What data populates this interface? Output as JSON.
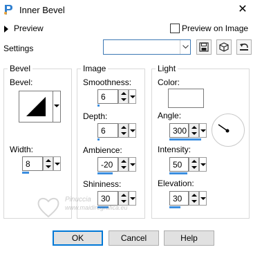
{
  "window": {
    "title": "Inner Bevel",
    "close_glyph": "✕",
    "icon": "psp-app-icon"
  },
  "preview": {
    "label": "Preview",
    "preview_on_image_label": "Preview on Image",
    "preview_on_image_checked": false
  },
  "settings": {
    "label": "Settings",
    "preset_value": ""
  },
  "bevel": {
    "group_title": "Bevel",
    "bevel_label": "Bevel:",
    "width_label": "Width:",
    "width_value": "8"
  },
  "image": {
    "group_title": "Image",
    "smoothness_label": "Smoothness:",
    "smoothness_value": "6",
    "depth_label": "Depth:",
    "depth_value": "6",
    "ambience_label": "Ambience:",
    "ambience_value": "-20",
    "shininess_label": "Shininess:",
    "shininess_value": "30"
  },
  "light": {
    "group_title": "Light",
    "color_label": "Color:",
    "color_value": "#ffffff",
    "angle_label": "Angle:",
    "angle_value": "300",
    "intensity_label": "Intensity:",
    "intensity_value": "50",
    "elevation_label": "Elevation:",
    "elevation_value": "30"
  },
  "watermark": {
    "line1": "Pinuccia",
    "line2": "www.maidiregrafica.eu"
  },
  "buttons": {
    "ok": "OK",
    "cancel": "Cancel",
    "help": "Help"
  },
  "colors": {
    "accent": "#0078d7",
    "slider": "#3b8ee0"
  }
}
